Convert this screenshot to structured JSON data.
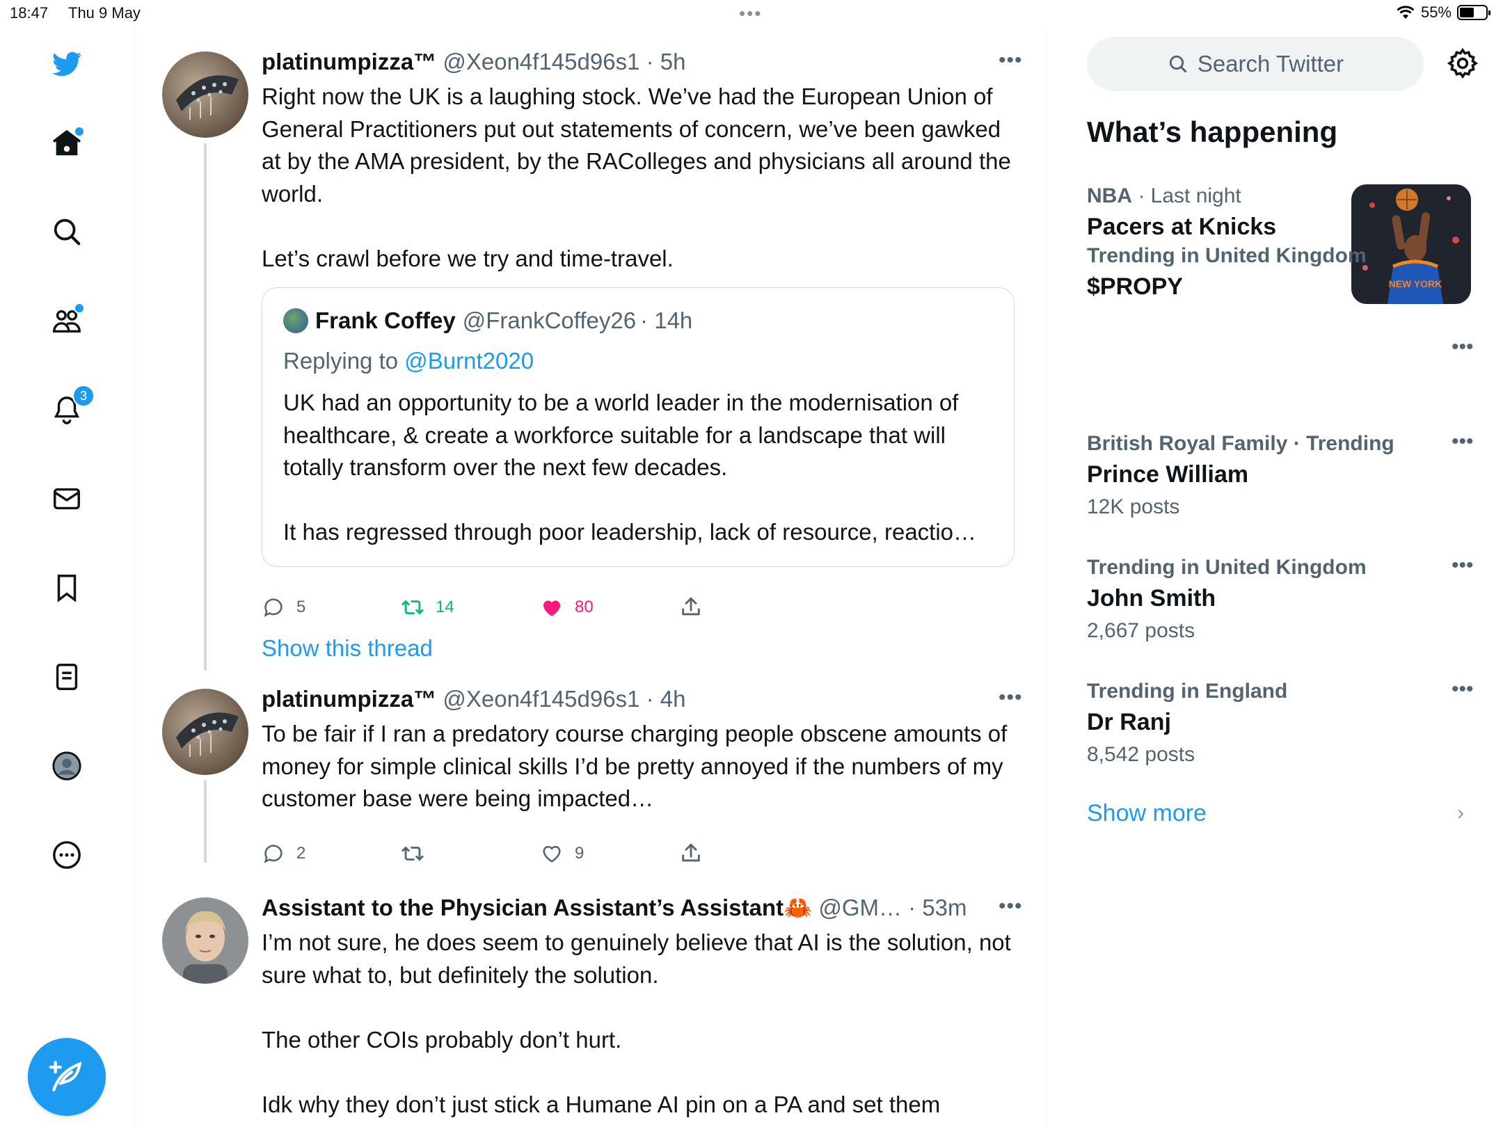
{
  "status_bar": {
    "time": "18:47",
    "date": "Thu 9 May",
    "battery": "55%",
    "battery_level": 0.55
  },
  "nav": {
    "items": [
      {
        "name": "twitter-logo-icon",
        "active": false
      },
      {
        "name": "home-icon",
        "dot": true
      },
      {
        "name": "search-icon"
      },
      {
        "name": "communities-icon",
        "dot": true
      },
      {
        "name": "notifications-icon",
        "badge": "3"
      },
      {
        "name": "messages-icon"
      },
      {
        "name": "bookmarks-icon"
      },
      {
        "name": "lists-icon"
      },
      {
        "name": "profile-icon"
      },
      {
        "name": "more-icon"
      }
    ],
    "notifications_badge": "3",
    "compose_icon": "compose-icon"
  },
  "colors": {
    "accent": "#1d9bf0",
    "like": "#f91880",
    "retweet": "#00ba7c",
    "secondary_text": "#536471"
  },
  "timeline": {
    "tweets": [
      {
        "name": "platinumpizza™",
        "handle": "@Xeon4f145d96s1",
        "time": "· 5h",
        "paragraphs": [
          "Right now the UK is a laughing stock. We’ve had the European Union of General Practitioners put out statements of concern, we’ve been gawked at by the AMA president, by the RAColleges and physicians all around the world.",
          "Let’s crawl before we try and time-travel."
        ],
        "quote": {
          "name": "Frank Coffey",
          "handle": "@FrankCoffey26",
          "time": "· 14h",
          "replying_prefix": "Replying to ",
          "replying_to": "@Burnt2020",
          "paragraphs": [
            "UK had an opportunity to be a world leader in the modernisation of healthcare, & create a workforce suitable for a landscape that will totally transform over the next few decades.",
            "It has regressed through poor leadership, lack of resource, reactio…"
          ]
        },
        "replies": "5",
        "retweets": "14",
        "likes": "80",
        "liked": true,
        "show_thread": "Show this thread"
      },
      {
        "name": "platinumpizza™",
        "handle": "@Xeon4f145d96s1",
        "time": "· 4h",
        "paragraphs": [
          "To be fair if I ran a predatory course charging people obscene amounts of money for simple clinical skills I’d be pretty annoyed if the numbers of my customer base were being impacted…"
        ],
        "replies": "2",
        "retweets": "",
        "likes": "9",
        "liked": false
      },
      {
        "name": "Assistant to the Physician Assistant’s Assistant🦀",
        "handle": "@GM…",
        "time": "· 53m",
        "paragraphs": [
          "I’m not sure, he does seem to genuinely believe that AI is the solution, not sure what to, but definitely the solution.",
          "The other COIs probably don’t hurt.",
          "Idk why they don’t just stick a Humane AI pin on a PA and set them"
        ]
      }
    ]
  },
  "sidebar": {
    "search_placeholder": "Search Twitter",
    "whats_happening": "What’s happening",
    "trends": [
      {
        "category": "NBA",
        "meta": " · Last night",
        "title": "Pacers at Knicks",
        "count": ""
      },
      {
        "category": "Trending in United Kingdom",
        "meta": "",
        "title": "$PROPY",
        "count": ""
      },
      {
        "category": "British Royal Family · Trending",
        "meta": "",
        "title": "Prince William",
        "count": "12K posts"
      },
      {
        "category": "Trending in United Kingdom",
        "meta": "",
        "title": "John Smith",
        "count": "2,667 posts"
      },
      {
        "category": "Trending in England",
        "meta": "",
        "title": "Dr Ranj",
        "count": "8,542 posts"
      }
    ],
    "show_more": "Show more"
  }
}
